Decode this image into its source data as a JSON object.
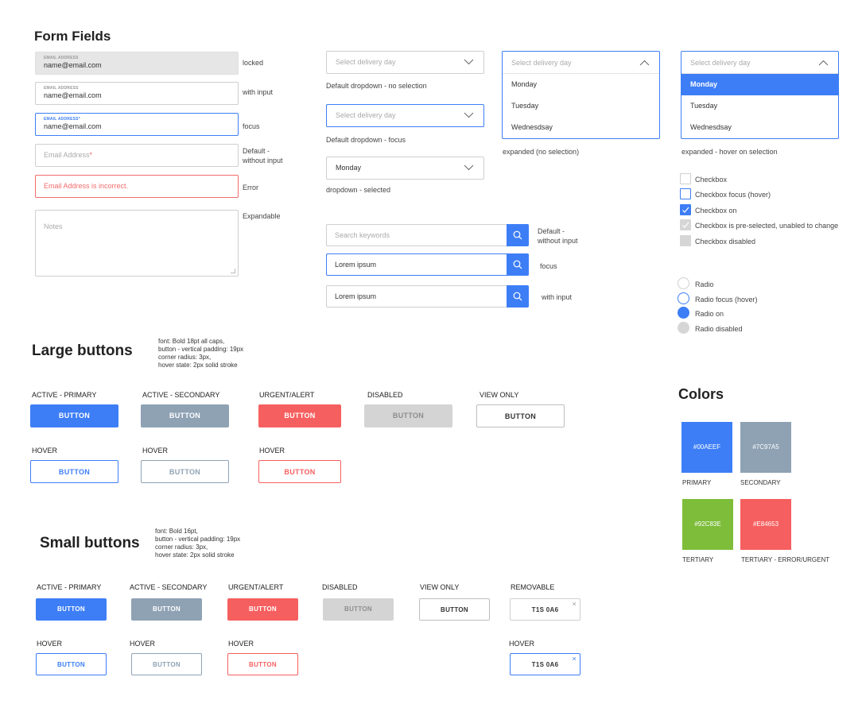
{
  "form_fields": {
    "title": "Form Fields",
    "text_fields": {
      "locked": {
        "label": "EMAIL ADDRESS",
        "value": "name@email.com",
        "caption": "locked"
      },
      "with_input": {
        "label": "EMAIL ADDRESS",
        "value": "name@email.com",
        "caption": "with input"
      },
      "focus": {
        "label": "EMAIL ADDRESS*",
        "value": "name@email.com",
        "caption": "focus"
      },
      "default": {
        "placeholder": "Email Address",
        "required_mark": "*",
        "caption": "Default -\nwithout input"
      },
      "error": {
        "message": "Email Address is incorrect.",
        "caption": "Error"
      },
      "notes": {
        "placeholder": "Notes",
        "caption": "Expandable"
      }
    },
    "dropdowns": {
      "default": {
        "placeholder": "Select delivery day",
        "caption": "Default dropdown - no selection"
      },
      "focus": {
        "placeholder": "Select delivery day",
        "caption": "Default dropdown - focus"
      },
      "selected": {
        "value": "Monday",
        "caption": "dropdown - selected"
      },
      "expanded": {
        "placeholder": "Select delivery day",
        "options": [
          "Monday",
          "Tuesday",
          "Wednesdsay"
        ],
        "caption": "expanded (no selection)"
      },
      "expanded_hover": {
        "placeholder": "Select delivery day",
        "options": [
          "Monday",
          "Tuesday",
          "Wednesdsay"
        ],
        "selected_index": 0,
        "caption": "expanded - hover on selection"
      }
    },
    "search": {
      "default": {
        "placeholder": "Search keywords",
        "caption": "Default -\nwithout input"
      },
      "focus": {
        "value": "Lorem ipsum",
        "caption": "focus"
      },
      "with_input": {
        "value": "Lorem ipsum",
        "caption": "with input"
      }
    },
    "checkboxes": [
      {
        "label": "Checkbox",
        "state": "default"
      },
      {
        "label": "Checkbox focus (hover)",
        "state": "focus"
      },
      {
        "label": "Checkbox on",
        "state": "on"
      },
      {
        "label": "Checkbox is pre-selected, unabled to change",
        "state": "preselected"
      },
      {
        "label": "Checkbox disabled",
        "state": "disabled"
      }
    ],
    "radios": [
      {
        "label": "Radio",
        "state": "default"
      },
      {
        "label": "Radio focus (hover)",
        "state": "focus"
      },
      {
        "label": "Radio on",
        "state": "on"
      },
      {
        "label": "Radio disabled",
        "state": "disabled"
      }
    ]
  },
  "large_buttons": {
    "title": "Large buttons",
    "note": "font: Bold 18pt all caps,\nbutton - vertical padding: 19px\ncorner radius: 3px,\nhover state: 2px solid stroke",
    "captions": {
      "primary": "ACTIVE - PRIMARY",
      "secondary": "ACTIVE - SECONDARY",
      "urgent": "URGENT/ALERT",
      "disabled": "DISABLED",
      "view": "VIEW ONLY",
      "hover_primary": "HOVER",
      "hover_secondary": "HOVER",
      "hover_urgent": "HOVER"
    },
    "button_label": "BUTTON"
  },
  "small_buttons": {
    "title": "Small buttons",
    "note": "font: Bold 16pt,\nbutton - vertical padding: 19px\ncorner radius: 3px,\nhover state: 2px solid stroke",
    "captions": {
      "primary": "ACTIVE - PRIMARY",
      "secondary": "ACTIVE - SECONDARY",
      "urgent": "URGENT/ALERT",
      "disabled": "DISABLED",
      "view": "VIEW ONLY",
      "removable": "REMOVABLE",
      "hover_primary": "HOVER",
      "hover_secondary": "HOVER",
      "hover_urgent": "HOVER",
      "hover_removable": "HOVER"
    },
    "button_label": "BUTTON",
    "removable_value": "T1S 0A6",
    "remove_glyph": "×"
  },
  "colors": {
    "title": "Colors",
    "swatches": [
      {
        "hex": "#00AEEF",
        "fill": "#3d7ef6",
        "name": "PRIMARY"
      },
      {
        "hex": "#7C97A5",
        "fill": "#8fa2b4",
        "name": "SECONDARY"
      },
      {
        "hex": "#92C83E",
        "fill": "#7ebd3a",
        "name": "TERTIARY"
      },
      {
        "hex": "#E84653",
        "fill": "#f65f5f",
        "name": "TERTIARY - ERROR/URGENT"
      }
    ]
  }
}
